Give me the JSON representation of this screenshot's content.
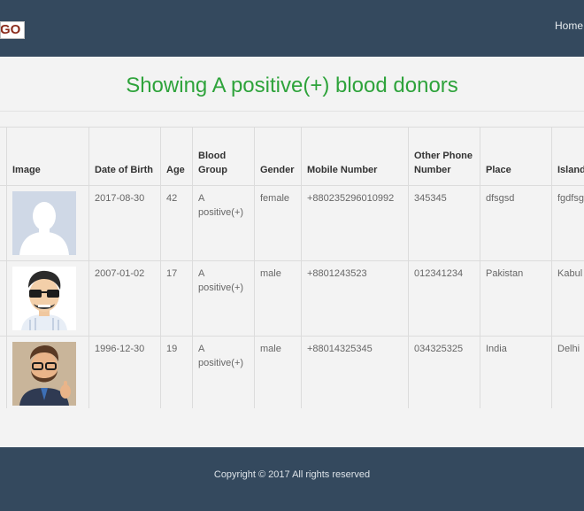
{
  "navbar": {
    "logo_text": "GO",
    "home_link": "Home"
  },
  "page": {
    "title": "Showing A positive(+) blood donors"
  },
  "table": {
    "headers": [
      "Image",
      "Date of Birth",
      "Age",
      "Blood Group",
      "Gender",
      "Mobile Number",
      "Other Phone Number",
      "Place",
      "Island"
    ],
    "rows": [
      {
        "avatar": "default-avatar-icon",
        "dob": "2017-08-30",
        "age": "42",
        "blood_group": "A positive(+)",
        "gender": "female",
        "mobile": "+880235296010992",
        "other_phone": "345345",
        "place": "dfsgsd",
        "island": "fgdfsg"
      },
      {
        "avatar": "cartoon-man-sunglasses-avatar",
        "dob": "2007-01-02",
        "age": "17",
        "blood_group": "A positive(+)",
        "gender": "male",
        "mobile": "+8801243523",
        "other_phone": "012341234",
        "place": "Pakistan",
        "island": "Kabul"
      },
      {
        "avatar": "cartoon-man-beard-thumbs-up-avatar",
        "dob": "1996-12-30",
        "age": "19",
        "blood_group": "A positive(+)",
        "gender": "male",
        "mobile": "+88014325345",
        "other_phone": "034325325",
        "place": "India",
        "island": "Delhi"
      }
    ]
  },
  "footer": {
    "copyright": "Copyright © 2017 All rights reserved"
  },
  "colors": {
    "navbar": "#34495e",
    "title": "#2ea33b",
    "background": "#f3f3f3"
  }
}
